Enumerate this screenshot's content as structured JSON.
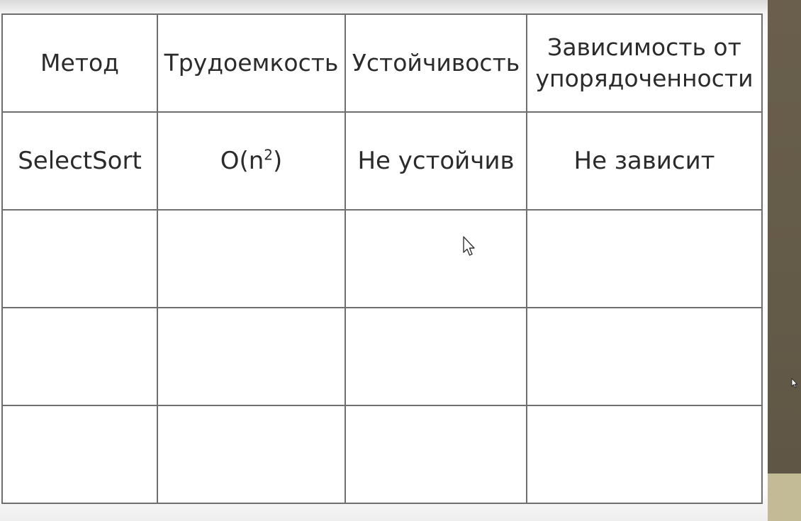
{
  "table": {
    "headers": [
      "Метод",
      "Трудоемкость",
      "Устойчивость",
      "Зависимость от упорядоченности"
    ],
    "rows": [
      {
        "method": "SelectSort",
        "complexity_base": "O(n",
        "complexity_exp": "2",
        "complexity_close": ")",
        "stability": "Не устойчив",
        "order_dependency": "Не зависит"
      },
      {
        "method": "",
        "complexity": "",
        "stability": "",
        "order_dependency": ""
      },
      {
        "method": "",
        "complexity": "",
        "stability": "",
        "order_dependency": ""
      },
      {
        "method": "",
        "complexity": "",
        "stability": "",
        "order_dependency": ""
      }
    ]
  },
  "colors": {
    "border": "#6f6f6f",
    "text": "#2b2b2b",
    "side_strip": "#645a48",
    "side_strip_bottom": "#c2bb95"
  },
  "icons": [
    "mouse-cursor-icon"
  ]
}
